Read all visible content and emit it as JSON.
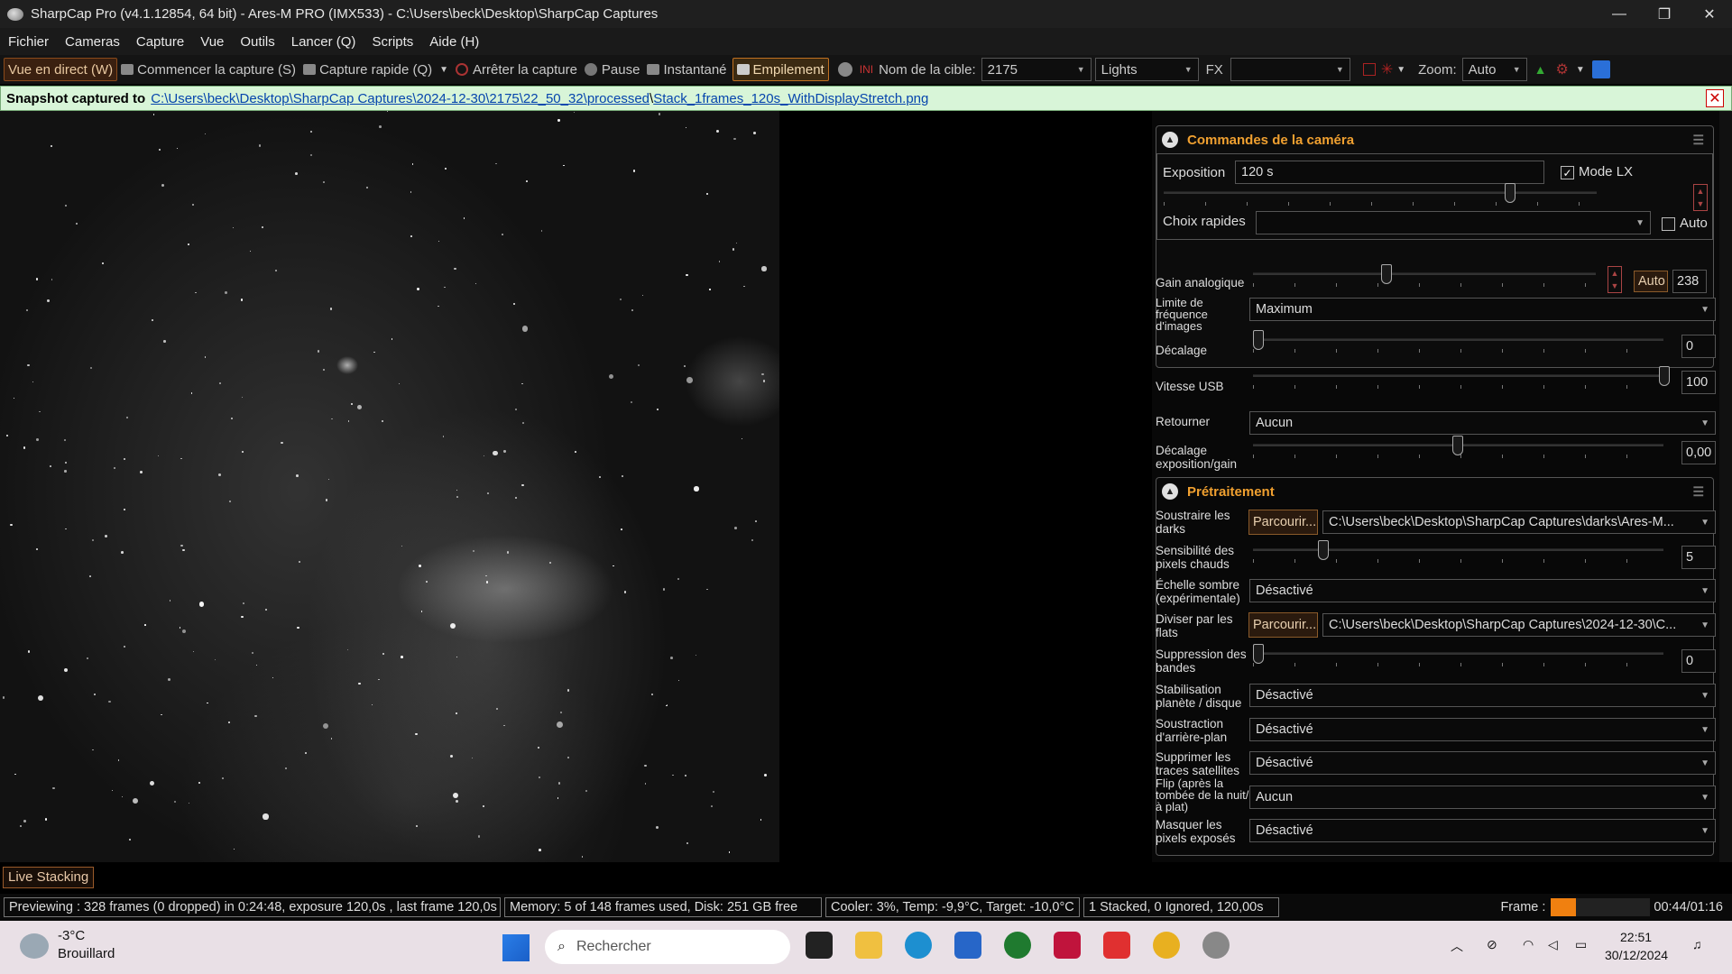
{
  "window": {
    "title": "SharpCap Pro (v4.1.12854, 64 bit) - Ares-M PRO (IMX533) - C:\\Users\\beck\\Desktop\\SharpCap Captures",
    "min": "—",
    "max": "❐",
    "close": "✕"
  },
  "menu": [
    "Fichier",
    "Cameras",
    "Capture",
    "Vue",
    "Outils",
    "Lancer (Q)",
    "Scripts",
    "Aide (H)"
  ],
  "toolbar": {
    "live": "Vue en direct (W)",
    "start": "Commencer la capture (S)",
    "quick": "Capture rapide (Q)",
    "stop": "Arrêter la capture",
    "pause": "Pause",
    "snapshot": "Instantané",
    "stack": "Empilement",
    "target_label": "Nom de la cible:",
    "target_value": "2175",
    "frame_type": "Lights",
    "fx_label": "FX",
    "fx_value": "",
    "zoom_label": "Zoom:",
    "zoom_value": "Auto"
  },
  "notification": {
    "prefix": "Snapshot captured to",
    "path_link": "C:\\Users\\beck\\Desktop\\SharpCap Captures\\2024-12-30\\2175\\22_50_32\\processed",
    "sep": "\\",
    "file_link": "Stack_1frames_120s_WithDisplayStretch.png"
  },
  "camera_controls": {
    "title": "Commandes de la caméra",
    "exposure_label": "Exposition",
    "exposure_value": "120 s",
    "lx_label": "Mode LX",
    "quick_label": "Choix rapides",
    "quick_value": "",
    "auto_label": "Auto",
    "gain_label": "Gain analogique",
    "gain_auto": "Auto",
    "gain_value": "238",
    "fps_label": "Limite de fréquence d'images",
    "fps_value": "Maximum",
    "offset_label": "Décalage",
    "offset_value": "0",
    "usb_label": "Vitesse USB",
    "usb_value": "100",
    "flip_label": "Retourner",
    "flip_value": "Aucun",
    "expgain_label": "Décalage exposition/gain",
    "expgain_value": "0,00"
  },
  "preprocessing": {
    "title": "Prétraitement",
    "darks_label": "Soustraire les darks",
    "browse": "Parcourir...",
    "darks_value": "C:\\Users\\beck\\Desktop\\SharpCap Captures\\darks\\Ares-M...",
    "hotpix_label": "Sensibilité des pixels chauds",
    "hotpix_value": "5",
    "darkscale_label": "Échelle sombre (expérimentale)",
    "darkscale_value": "Désactivé",
    "flats_label": "Diviser par les flats",
    "flats_value": "C:\\Users\\beck\\Desktop\\SharpCap Captures\\2024-12-30\\C...",
    "banding_label": "Suppression des bandes",
    "banding_value": "0",
    "stab_label": "Stabilisation planète / disque",
    "stab_value": "Désactivé",
    "bg_label": "Soustraction d'arrière-plan",
    "bg_value": "Désactivé",
    "sat_label": "Supprimer les traces satellites",
    "sat_value": "Désactivé",
    "flipflat_label": "Flip (après la tombée de la nuit/à plat)",
    "flipflat_value": "Aucun",
    "mask_label": "Masquer les pixels exposés",
    "mask_value": "Désactivé"
  },
  "live_stacking": "Live Stacking",
  "status": {
    "preview": "Previewing : 328 frames (0 dropped) in 0:24:48, exposure 120,0s , last frame 120,0s",
    "memory": "Memory: 5 of 148 frames used, Disk: 251 GB free",
    "cooler": "Cooler: 3%, Temp: -9,9°C, Target: -10,0°C",
    "stacked": "1 Stacked, 0 Ignored, 120,00s",
    "frame_label": "Frame :",
    "frame_progress": 0.25,
    "time": "00:44/01:16"
  },
  "taskbar": {
    "weather_temp": "-3°C",
    "weather_desc": "Brouillard",
    "search_placeholder": "Rechercher",
    "clock_time": "22:51",
    "clock_date": "30/12/2024"
  }
}
